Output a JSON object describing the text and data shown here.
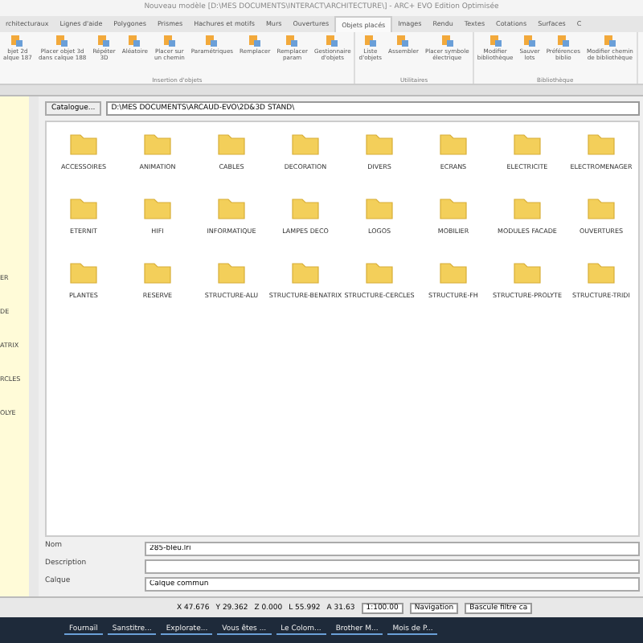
{
  "window": {
    "title": "Nouveau modèle [D:\\MES DOCUMENTS\\INTERACT\\ARCHITECTURE\\] - ARC+ EVO Edition Optimisée"
  },
  "tabs": [
    {
      "label": "rchitecturaux",
      "selected": false
    },
    {
      "label": "Lignes d'aide",
      "selected": false
    },
    {
      "label": "Polygones",
      "selected": false
    },
    {
      "label": "Prismes",
      "selected": false
    },
    {
      "label": "Hachures et motifs",
      "selected": false
    },
    {
      "label": "Murs",
      "selected": false
    },
    {
      "label": "Ouvertures",
      "selected": false
    },
    {
      "label": "Objets placés",
      "selected": true
    },
    {
      "label": "Images",
      "selected": false
    },
    {
      "label": "Rendu",
      "selected": false
    },
    {
      "label": "Textes",
      "selected": false
    },
    {
      "label": "Cotations",
      "selected": false
    },
    {
      "label": "Surfaces",
      "selected": false
    },
    {
      "label": "C",
      "selected": false
    }
  ],
  "ribbon_groups": [
    {
      "label": "Insertion d'objets",
      "buttons": [
        "bjet 2d\nalque 187",
        "Placer objet 3d\ndans calque 188",
        "Répéter\n3D",
        "Aléatoire",
        "Placer sur\nun chemin",
        "Paramétriques",
        "Remplacer",
        "Remplacer\nparam",
        "Gestionnaire\nd'objets"
      ]
    },
    {
      "label": "Utilitaires",
      "buttons": [
        "Liste\nd'objets",
        "Assembler",
        "Placer symbole\nélectrique"
      ]
    },
    {
      "label": "Bibliothèque",
      "buttons": [
        "Modifier\nbibliothèque",
        "Sauver\nlots",
        "Préférences\nbiblio",
        "Modifier chemin\nde bibliothèque"
      ]
    }
  ],
  "side_panel": {
    "items": [
      "ER",
      "DE",
      "ATRIX",
      "RCLES",
      "OLYE"
    ]
  },
  "catalogue": {
    "button": "Catalogue...",
    "path": "D:\\MES DOCUMENTS\\ARCAUD-EVO\\2D&3D STAND\\"
  },
  "folders": [
    "ACCESSOIRES",
    "ANIMATION",
    "CABLES",
    "DECORATION",
    "DIVERS",
    "ECRANS",
    "ELECTRICITE",
    "ELECTROMENAGER",
    "ETERNIT",
    "HIFI",
    "INFORMATIQUE",
    "LAMPES DECO",
    "LOGOS",
    "MOBILIER",
    "MODULES FACADE",
    "OUVERTURES",
    "PLANTES",
    "RESERVE",
    "STRUCTURE-ALU",
    "STRUCTURE-BENATRIX",
    "STRUCTURE-CERCLES",
    "STRUCTURE-FH",
    "STRUCTURE-PROLYTE",
    "STRUCTURE-TRIDI"
  ],
  "form": [
    {
      "label": "Nom",
      "value": "285-bleu.lri"
    },
    {
      "label": "Description"
    },
    {
      "label": "Calque",
      "value": "Calque commun"
    }
  ],
  "status_bar": {
    "coords": [
      {
        "axis": "X",
        "value": "47.676"
      },
      {
        "axis": "Y",
        "value": "29.362"
      },
      {
        "axis": "Z",
        "value": "0.000"
      }
    ],
    "length": "L 55.992",
    "angle": "A 31.63",
    "scale": "1:100.00",
    "mode": "Navigation",
    "filter": "Bascule filtre ca"
  },
  "taskbar": [
    "Fournaïl",
    "Sanstitre...",
    "Explorate...",
    "Vous êtes ...",
    "Le Colom...",
    "Brother M...",
    "Mois de P..."
  ]
}
